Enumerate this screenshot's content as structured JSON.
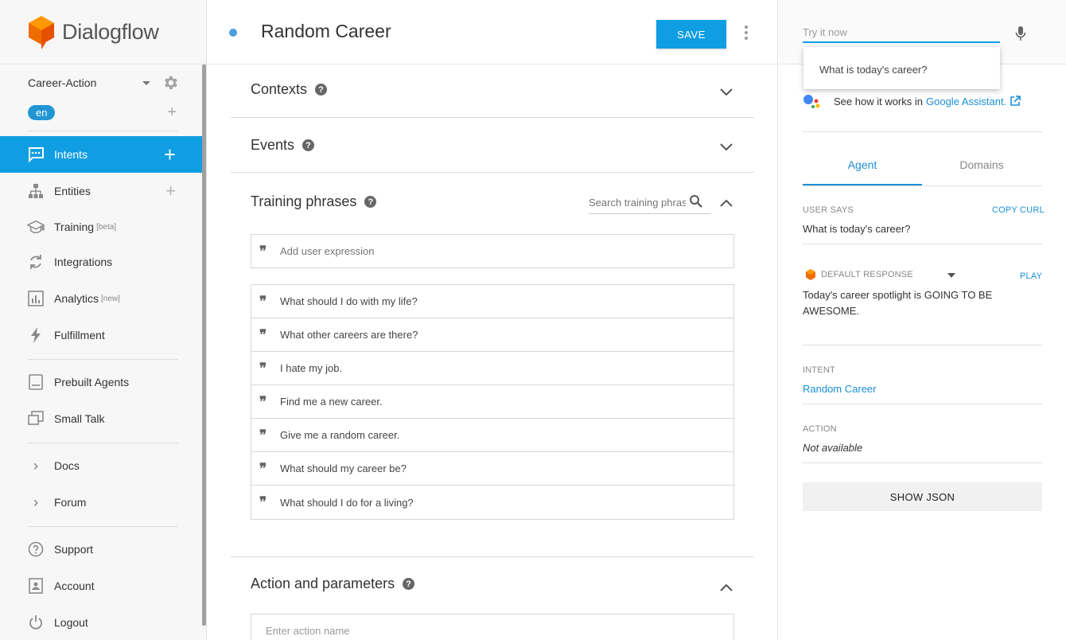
{
  "app": {
    "name": "Dialogflow"
  },
  "sidebar": {
    "agent_name": "Career-Action",
    "language": "en",
    "items": [
      {
        "label": "Intents",
        "icon": "chat-bubble-icon",
        "tag": ""
      },
      {
        "label": "Entities",
        "icon": "hierarchy-icon",
        "tag": ""
      },
      {
        "label": "Training",
        "icon": "graduation-cap-icon",
        "tag": "[beta]"
      },
      {
        "label": "Integrations",
        "icon": "sync-icon",
        "tag": ""
      },
      {
        "label": "Analytics",
        "icon": "bar-chart-icon",
        "tag": "[new]"
      },
      {
        "label": "Fulfillment",
        "icon": "lightning-icon",
        "tag": ""
      },
      {
        "label": "Prebuilt Agents",
        "icon": "book-icon",
        "tag": ""
      },
      {
        "label": "Small Talk",
        "icon": "small-talk-icon",
        "tag": ""
      },
      {
        "label": "Docs",
        "icon": "chevron-right-icon",
        "tag": ""
      },
      {
        "label": "Forum",
        "icon": "chevron-right-icon",
        "tag": ""
      },
      {
        "label": "Support",
        "icon": "help-circle-icon",
        "tag": ""
      },
      {
        "label": "Account",
        "icon": "account-icon",
        "tag": ""
      },
      {
        "label": "Logout",
        "icon": "power-icon",
        "tag": ""
      }
    ],
    "active_color": "#0f9ee2"
  },
  "intent": {
    "title": "Random Career",
    "save_label": "SAVE",
    "sections": {
      "contexts": "Contexts",
      "events": "Events",
      "training": "Training phrases",
      "action": "Action and parameters"
    },
    "search_placeholder": "Search training phrases",
    "add_expression_placeholder": "Add user expression",
    "phrases": [
      "What should I do with my life?",
      "What other careers are there?",
      "I hate my job.",
      "Find me a new career.",
      "Give me a random career.",
      "What should my career be?",
      "What should I do for a living?"
    ],
    "action_placeholder": "Enter action name"
  },
  "test_panel": {
    "try_placeholder": "Try it now",
    "suggestion": "What is today's career?",
    "ga_text": "See how it works in",
    "ga_link": "Google Assistant.",
    "tabs": [
      "Agent",
      "Domains"
    ],
    "user_says_label": "USER SAYS",
    "copy_curl": "COPY CURL",
    "user_says_value": "What is today's career?",
    "default_response_label": "DEFAULT RESPONSE",
    "play_label": "PLAY",
    "response_text": "Today's career spotlight is GOING TO BE AWESOME.",
    "intent_label": "INTENT",
    "intent_value": "Random Career",
    "action_label": "ACTION",
    "action_value": "Not available",
    "show_json": "SHOW JSON"
  }
}
